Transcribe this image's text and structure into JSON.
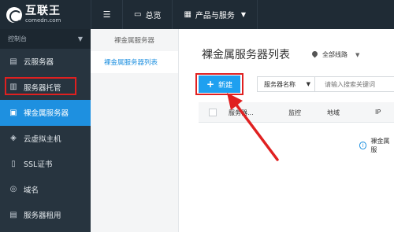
{
  "brand": {
    "name": "互联王",
    "domain": "comedn.com"
  },
  "topnav": {
    "items": [
      {
        "label": "总览",
        "icon": "monitor-icon"
      },
      {
        "label": "产品与服务",
        "icon": "grid-icon"
      }
    ]
  },
  "sidebar": {
    "header": "控制台",
    "items": [
      {
        "label": "云服务器",
        "icon": "server-icon"
      },
      {
        "label": "服务器托管",
        "icon": "rack-icon"
      },
      {
        "label": "裸金属服务器",
        "icon": "baremetal-icon",
        "active": true
      },
      {
        "label": "云虚拟主机",
        "icon": "cube-icon"
      },
      {
        "label": "SSL证书",
        "icon": "certificate-icon"
      },
      {
        "label": "域名",
        "icon": "globe-icon"
      },
      {
        "label": "服务器租用",
        "icon": "server-rent-icon"
      }
    ]
  },
  "subpanel": {
    "title": "裸金属服务器",
    "items": [
      {
        "label": "裸金属服务器列表",
        "active": true
      }
    ]
  },
  "main": {
    "title": "裸金属服务器列表",
    "region": "全部线路",
    "new_button": "新建",
    "filter_select": "服务器名称",
    "search_placeholder": "请输入搜索关键词",
    "columns": [
      "服务器...",
      "监控",
      "地域",
      "IP"
    ],
    "empty_text": "裸金属服"
  },
  "colors": {
    "accent": "#1ea0f0",
    "sidebar_active": "#1e90e0",
    "highlight": "#e02020",
    "topbar": "#1f2b35"
  }
}
